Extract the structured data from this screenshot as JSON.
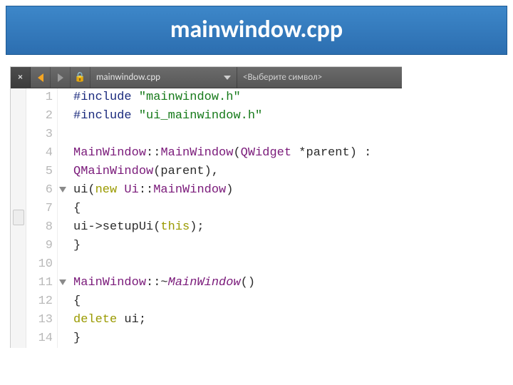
{
  "banner": {
    "title": "mainwindow.cpp"
  },
  "toolbar": {
    "file_name": "mainwindow.cpp",
    "symbol_placeholder": "<Выберите символ>"
  },
  "line_numbers": [
    "1",
    "2",
    "3",
    "4",
    "5",
    "6",
    "7",
    "8",
    "9",
    "10",
    "11",
    "12",
    "13",
    "14"
  ],
  "fold_marks": [
    6,
    11
  ],
  "code": {
    "l1": {
      "a": "#include ",
      "b": "\"mainwindow.h\""
    },
    "l2": {
      "a": "#include ",
      "b": "\"ui_mainwindow.h\""
    },
    "l3": "",
    "l4": {
      "a": "MainWindow",
      "b": "::",
      "c": "MainWindow",
      "d": "(",
      "e": "QWidget",
      "f": " *parent) :"
    },
    "l5": {
      "a": "      ",
      "b": "QMainWindow",
      "c": "(parent),"
    },
    "l6": {
      "a": "      ui(",
      "b": "new",
      "c": " ",
      "d": "Ui",
      "e": "::",
      "f": "MainWindow",
      "g": ")"
    },
    "l7": "{",
    "l8": {
      "a": "      ui->setupUi(",
      "b": "this",
      "c": ");"
    },
    "l9": "}",
    "l10": "",
    "l11": {
      "a": "MainWindow",
      "b": "::~",
      "c": "MainWindow",
      "d": "()"
    },
    "l12": "{",
    "l13": {
      "a": "      ",
      "b": "delete",
      "c": " ui;"
    },
    "l14": "}"
  }
}
